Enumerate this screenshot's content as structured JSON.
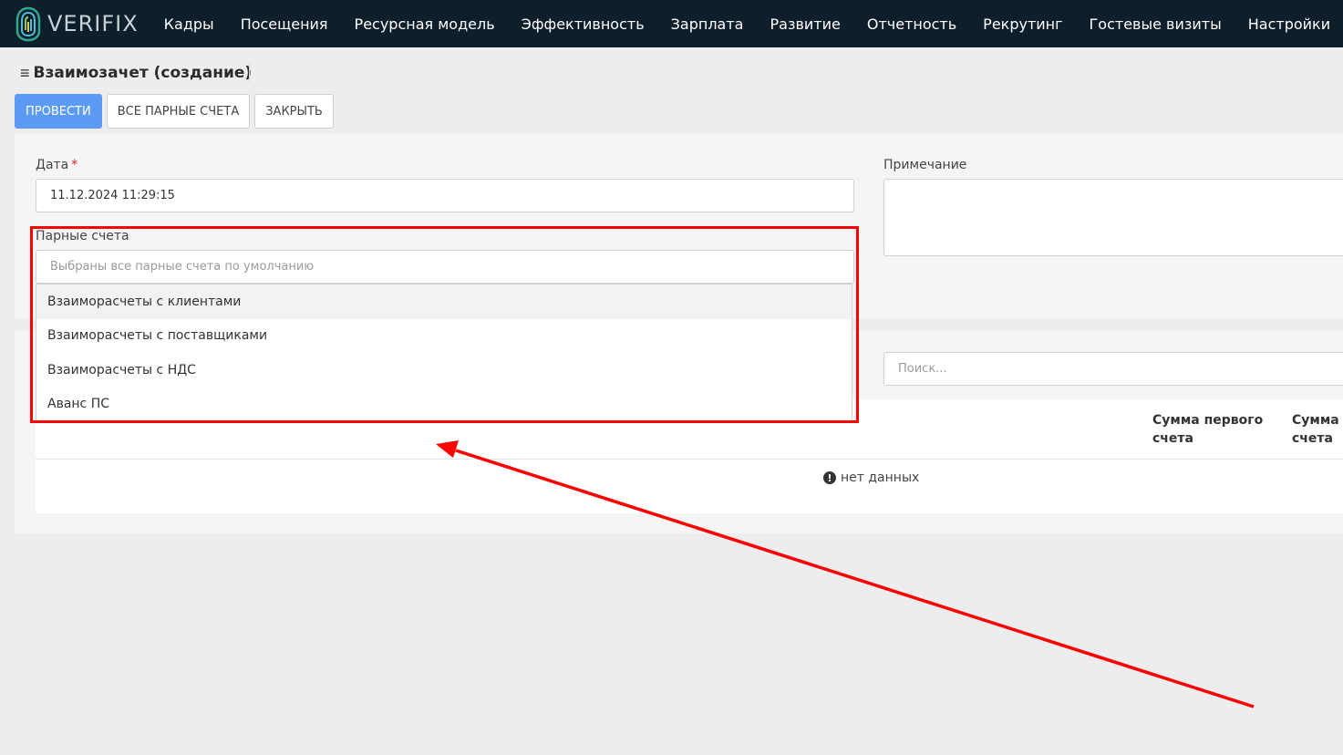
{
  "app": {
    "logo_text": "VERIFIX",
    "nav": [
      "Кадры",
      "Посещения",
      "Ресурсная модель",
      "Эффективность",
      "Зарплата",
      "Развитие",
      "Отчетность",
      "Рекрутинг",
      "Гостевые визиты",
      "Настройки"
    ]
  },
  "page": {
    "title": "Взаимозачет (создание)",
    "menu_icon": "hamburger-icon"
  },
  "toolbar": {
    "post_label": "ПРОВЕСТИ",
    "all_pairs_label": "ВСЕ ПАРНЫЕ СЧЕТА",
    "close_label": "ЗАКРЫТЬ"
  },
  "form": {
    "date_label": "Дата",
    "date_required_mark": "*",
    "date_value": "11.12.2024 11:29:15",
    "note_label": "Примечание",
    "note_value": "",
    "pair_accounts_label": "Парные счета",
    "pair_accounts_placeholder": "Выбраны все парные счета по умолчанию",
    "pair_accounts_options": [
      "Взаиморасчеты с клиентами",
      "Взаиморасчеты с поставщиками",
      "Взаиморасчеты с НДС",
      "Аванс ПС"
    ]
  },
  "grid": {
    "search_placeholder": "Поиск...",
    "columns": [
      "Сумма первого счета",
      "Сумма второго счета"
    ],
    "empty_text": "нет данных"
  },
  "colors": {
    "topbar": "#0e1e2a",
    "primary_button": "#5c9bf5",
    "annotation": "#ff0000"
  }
}
